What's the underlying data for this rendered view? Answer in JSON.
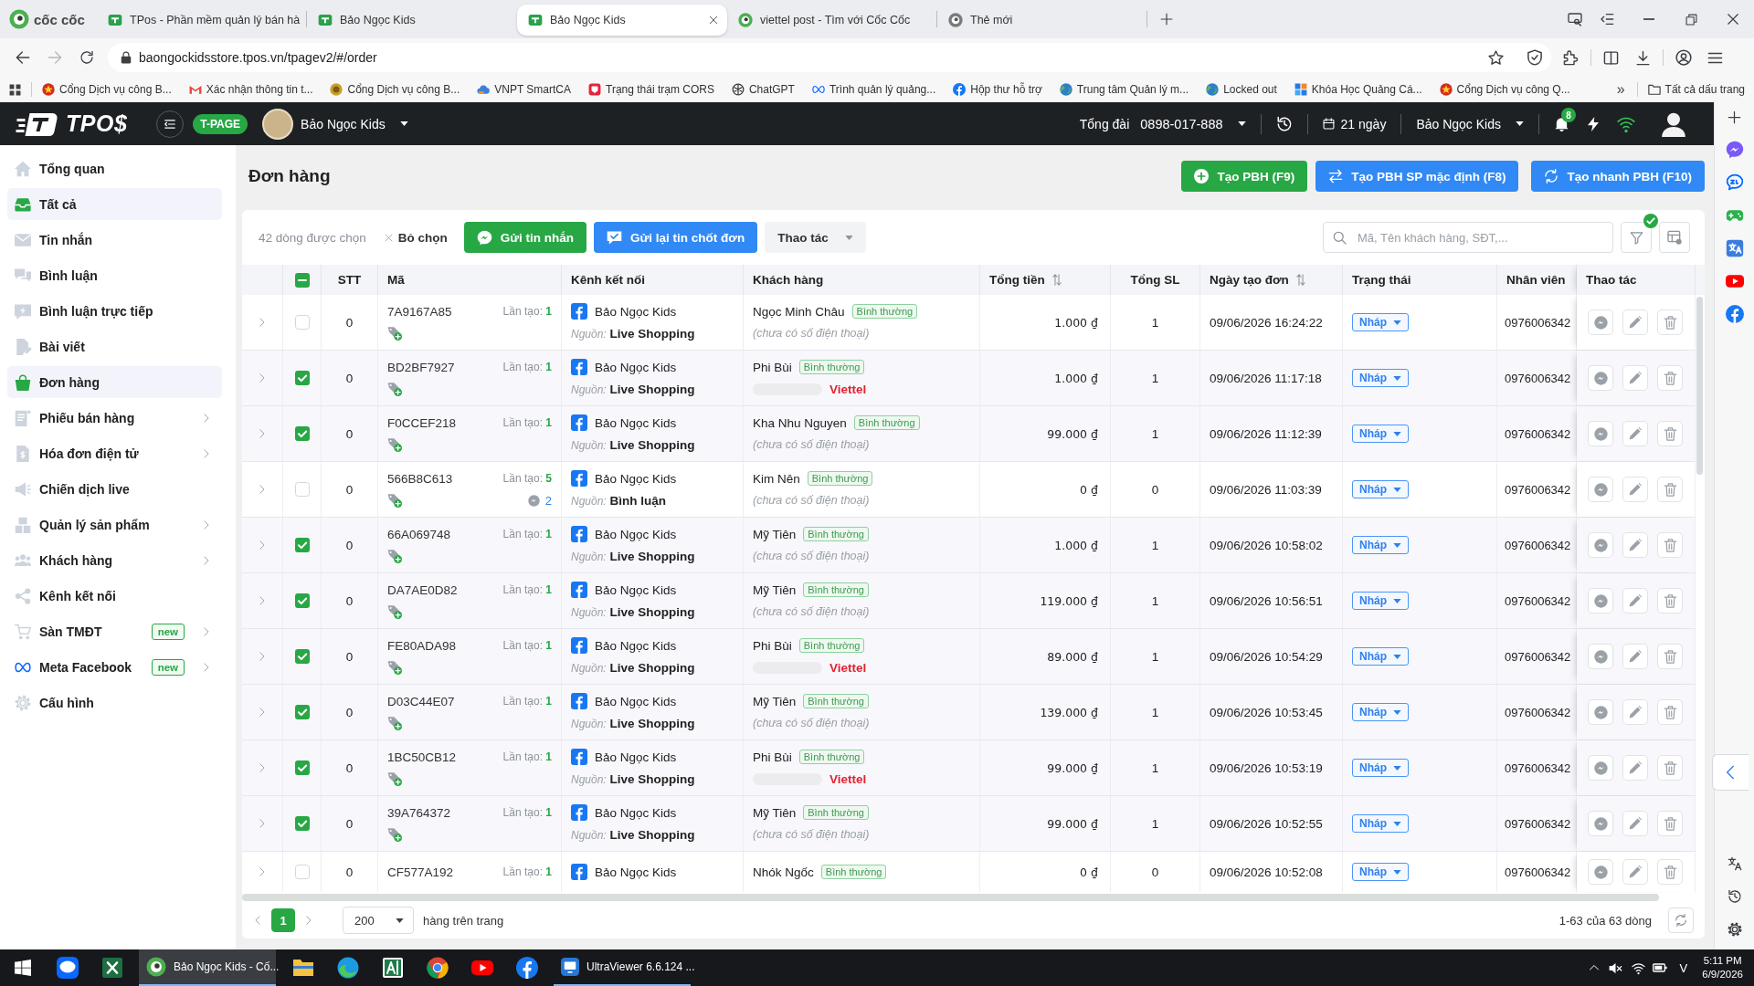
{
  "browser": {
    "logo": "cốc cốc",
    "tabs": [
      {
        "title": "TPos - Phần mềm quản lý bán hà",
        "selected": false
      },
      {
        "title": "Bảo Ngọc Kids",
        "selected": false
      },
      {
        "title": "Bảo Ngọc Kids",
        "selected": true
      },
      {
        "title": "viettel post - Tìm với Cốc Cốc",
        "selected": false
      },
      {
        "title": "Thẻ mới",
        "selected": false
      }
    ],
    "forward_disabled": true,
    "address": "baongockidsstore.tpos.vn/tpagev2/#/order",
    "bookmarks": [
      "Cổng Dịch vụ công B...",
      "Xác nhận thông tin t...",
      "Cổng Dịch vụ công B...",
      "VNPT SmartCA",
      "Trạng thái trạm CORS",
      "ChatGPT",
      "Trình quản lý quảng...",
      "Hộp thư hỗ trợ",
      "Trung tâm Quản lý m...",
      "Locked out",
      "Khóa Học Quảng Cá...",
      "Cổng Dịch vụ công Q..."
    ],
    "more_bookmarks": "»",
    "all_bookmarks": "Tất cả dấu trang"
  },
  "app_header": {
    "logo": "TPO$",
    "product": "T-PAGE",
    "shop": "Bảo Ngọc Kids",
    "hotline_label": "Tổng đài",
    "hotline": "0898-017-888",
    "days_left": "21 ngày",
    "account": "Bảo Ngọc Kids",
    "notifications": "8"
  },
  "sidebar": {
    "items": [
      {
        "label": "Tổng quan",
        "selected": false,
        "submenu": false
      },
      {
        "label": "Tất cả",
        "selected": true,
        "submenu": false
      },
      {
        "label": "Tin nhắn",
        "selected": false,
        "submenu": false
      },
      {
        "label": "Bình luận",
        "selected": false,
        "submenu": false
      },
      {
        "label": "Bình luận trực tiếp",
        "selected": false,
        "submenu": false
      },
      {
        "label": "Bài viết",
        "selected": false,
        "submenu": false
      },
      {
        "label": "Đơn hàng",
        "selected": true,
        "submenu": false
      },
      {
        "label": "Phiếu bán hàng",
        "selected": false,
        "submenu": true
      },
      {
        "label": "Hóa đơn điện tử",
        "selected": false,
        "submenu": true
      },
      {
        "label": "Chiến dịch live",
        "selected": false,
        "submenu": false
      },
      {
        "label": "Quản lý sản phẩm",
        "selected": false,
        "submenu": true
      },
      {
        "label": "Khách hàng",
        "selected": false,
        "submenu": true
      },
      {
        "label": "Kênh kết nối",
        "selected": false,
        "submenu": false
      },
      {
        "label": "Sàn TMĐT",
        "selected": false,
        "submenu": true,
        "badge": "new"
      },
      {
        "label": "Meta Facebook",
        "selected": false,
        "submenu": true,
        "badge": "new"
      },
      {
        "label": "Cấu hình",
        "selected": false,
        "submenu": false
      }
    ]
  },
  "page": {
    "title": "Đơn hàng",
    "actions": [
      {
        "label": "Tạo PBH (F9)",
        "kind": "success"
      },
      {
        "label": "Tạo PBH SP mặc định (F8)",
        "kind": "primary"
      },
      {
        "label": "Tạo nhanh PBH (F10)",
        "kind": "primary"
      }
    ]
  },
  "toolbar": {
    "selection": "42 dòng được chọn",
    "clear": "Bỏ chọn",
    "actions": [
      {
        "label": "Gửi tin nhắn",
        "kind": "success"
      },
      {
        "label": "Gửi lại tin chốt đơn",
        "kind": "primary"
      }
    ],
    "more": "Thao tác",
    "search": {
      "placeholder": "Mã, Tên khách hàng, SĐT,..."
    },
    "filter_active": true
  },
  "table": {
    "select_all": {
      "checked": true,
      "partial": true
    },
    "columns": [
      {
        "label": "STT",
        "sortable": false
      },
      {
        "label": "Mã",
        "sortable": false
      },
      {
        "label": "Kênh kết nối",
        "sortable": false
      },
      {
        "label": "Khách hàng",
        "sortable": false
      },
      {
        "label": "Tổng tiền",
        "sortable": true
      },
      {
        "label": "Tổng SL",
        "sortable": false
      },
      {
        "label": "Ngày tạo đơn",
        "sortable": true
      },
      {
        "label": "Trạng thái",
        "sortable": false
      },
      {
        "label": "Nhân viên",
        "sortable": false
      },
      {
        "label": "Thao tác",
        "sortable": false
      }
    ],
    "rows": [
      {
        "selected": false,
        "stt": "0",
        "code": "7A9167A85",
        "attempts_label": "Lần tạo:",
        "attempts": "1",
        "channel": "Bảo Ngọc Kids",
        "source_label": "Nguồn:",
        "source": "Live Shopping",
        "customer": "Ngọc Minh Châu",
        "customer_tag": "Bình thường",
        "contact": {
          "kind": "none",
          "note": "(chưa có số điện thoại)"
        },
        "total": "1.000 ₫",
        "quantity": "1",
        "created_at": "09/06/2026 16:24:22",
        "status": "Nháp",
        "staff": "0976006342"
      },
      {
        "selected": true,
        "stt": "0",
        "code": "BD2BF7927",
        "attempts_label": "Lần tạo:",
        "attempts": "1",
        "channel": "Bảo Ngọc Kids",
        "source_label": "Nguồn:",
        "source": "Live Shopping",
        "customer": "Phi Bùi",
        "customer_tag": "Bình thường",
        "contact": {
          "kind": "redacted",
          "carrier": "Viettel"
        },
        "total": "1.000 ₫",
        "quantity": "1",
        "created_at": "09/06/2026 11:17:18",
        "status": "Nháp",
        "staff": "0976006342"
      },
      {
        "selected": true,
        "stt": "0",
        "code": "F0CCEF218",
        "attempts_label": "Lần tạo:",
        "attempts": "1",
        "channel": "Bảo Ngọc Kids",
        "source_label": "Nguồn:",
        "source": "Live Shopping",
        "customer": "Kha Nhu Nguyen",
        "customer_tag": "Bình thường",
        "contact": {
          "kind": "none",
          "note": "(chưa có số điện thoại)"
        },
        "total": "99.000 ₫",
        "quantity": "1",
        "created_at": "09/06/2026 11:12:39",
        "status": "Nháp",
        "staff": "0976006342"
      },
      {
        "selected": false,
        "stt": "0",
        "code": "566B8C613",
        "attempts_label": "Lần tạo:",
        "attempts": "5",
        "comments": "2",
        "channel": "Bảo Ngọc Kids",
        "source_label": "Nguồn:",
        "source": "Bình luận",
        "customer": "Kim Nên",
        "customer_tag": "Bình thường",
        "contact": {
          "kind": "none",
          "note": "(chưa có số điện thoại)"
        },
        "total": "0 ₫",
        "quantity": "0",
        "created_at": "09/06/2026 11:03:39",
        "status": "Nháp",
        "staff": "0976006342"
      },
      {
        "selected": true,
        "stt": "0",
        "code": "66A069748",
        "attempts_label": "Lần tạo:",
        "attempts": "1",
        "channel": "Bảo Ngọc Kids",
        "source_label": "Nguồn:",
        "source": "Live Shopping",
        "customer": "Mỹ Tiên",
        "customer_tag": "Bình thường",
        "contact": {
          "kind": "none",
          "note": "(chưa có số điện thoại)"
        },
        "total": "1.000 ₫",
        "quantity": "1",
        "created_at": "09/06/2026 10:58:02",
        "status": "Nháp",
        "staff": "0976006342"
      },
      {
        "selected": true,
        "stt": "0",
        "code": "DA7AE0D82",
        "attempts_label": "Lần tạo:",
        "attempts": "1",
        "channel": "Bảo Ngọc Kids",
        "source_label": "Nguồn:",
        "source": "Live Shopping",
        "customer": "Mỹ Tiên",
        "customer_tag": "Bình thường",
        "contact": {
          "kind": "none",
          "note": "(chưa có số điện thoại)"
        },
        "total": "119.000 ₫",
        "quantity": "1",
        "created_at": "09/06/2026 10:56:51",
        "status": "Nháp",
        "staff": "0976006342"
      },
      {
        "selected": true,
        "stt": "0",
        "code": "FE80ADA98",
        "attempts_label": "Lần tạo:",
        "attempts": "1",
        "channel": "Bảo Ngọc Kids",
        "source_label": "Nguồn:",
        "source": "Live Shopping",
        "customer": "Phi Bùi",
        "customer_tag": "Bình thường",
        "contact": {
          "kind": "redacted",
          "carrier": "Viettel"
        },
        "total": "89.000 ₫",
        "quantity": "1",
        "created_at": "09/06/2026 10:54:29",
        "status": "Nháp",
        "staff": "0976006342"
      },
      {
        "selected": true,
        "stt": "0",
        "code": "D03C44E07",
        "attempts_label": "Lần tạo:",
        "attempts": "1",
        "channel": "Bảo Ngọc Kids",
        "source_label": "Nguồn:",
        "source": "Live Shopping",
        "customer": "Mỹ Tiên",
        "customer_tag": "Bình thường",
        "contact": {
          "kind": "none",
          "note": "(chưa có số điện thoại)"
        },
        "total": "139.000 ₫",
        "quantity": "1",
        "created_at": "09/06/2026 10:53:45",
        "status": "Nháp",
        "staff": "0976006342"
      },
      {
        "selected": true,
        "stt": "0",
        "code": "1BC50CB12",
        "attempts_label": "Lần tạo:",
        "attempts": "1",
        "channel": "Bảo Ngọc Kids",
        "source_label": "Nguồn:",
        "source": "Live Shopping",
        "customer": "Phi Bùi",
        "customer_tag": "Bình thường",
        "contact": {
          "kind": "redacted",
          "carrier": "Viettel"
        },
        "total": "99.000 ₫",
        "quantity": "1",
        "created_at": "09/06/2026 10:53:19",
        "status": "Nháp",
        "staff": "0976006342"
      },
      {
        "selected": true,
        "stt": "0",
        "code": "39A764372",
        "attempts_label": "Lần tạo:",
        "attempts": "1",
        "channel": "Bảo Ngọc Kids",
        "source_label": "Nguồn:",
        "source": "Live Shopping",
        "customer": "Mỹ Tiên",
        "customer_tag": "Bình thường",
        "contact": {
          "kind": "none",
          "note": "(chưa có số điện thoại)"
        },
        "total": "99.000 ₫",
        "quantity": "1",
        "created_at": "09/06/2026 10:52:55",
        "status": "Nháp",
        "staff": "0976006342"
      },
      {
        "selected": false,
        "stt": "0",
        "code": "CF577A192",
        "attempts_label": "Lần tạo:",
        "attempts": "1",
        "channel": "Bảo Ngọc Kids",
        "customer": "Nhók Ngốc",
        "customer_tag": "Bình thường",
        "total": "0 ₫",
        "quantity": "0",
        "created_at": "09/06/2026 10:52:08",
        "status": "Nháp",
        "staff": "0976006342"
      }
    ]
  },
  "footer": {
    "pages": [
      {
        "label": "1",
        "selected": true
      }
    ],
    "page_size": "200",
    "page_size_label": "hàng trên trang",
    "range": "1-63 của 63 dòng"
  },
  "taskbar": {
    "windows": [
      {
        "label": "Bảo Ngọc Kids - Cố...",
        "selected": true
      },
      {
        "label": "UltraViewer 6.6.124 ...",
        "selected": false
      }
    ],
    "input_method": "V",
    "time": "5:11 PM",
    "date": "6/9/2026"
  }
}
